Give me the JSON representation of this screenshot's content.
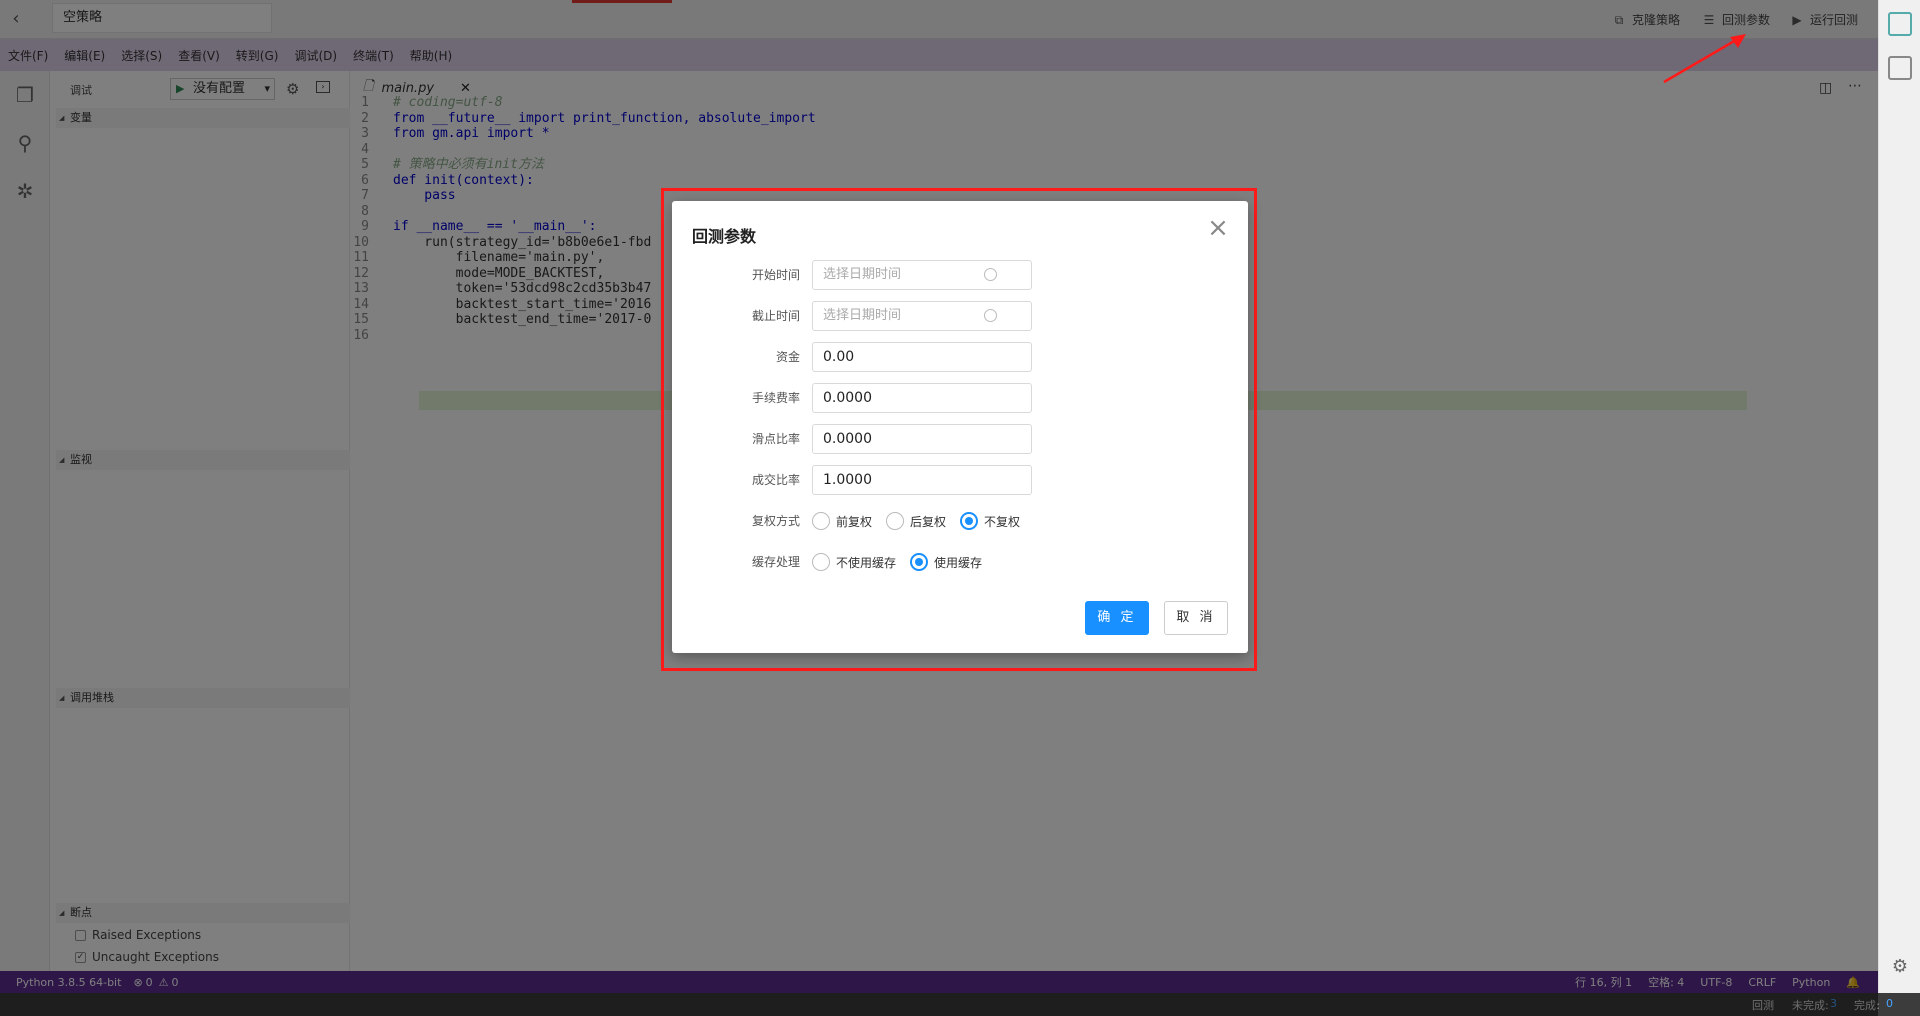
{
  "app": {
    "title": "空策略",
    "toolbar": {
      "clone_label": "克隆策略",
      "backtest_params_label": "回测参数",
      "run_backtest_label": "运行回测"
    }
  },
  "menu": [
    "文件(F)",
    "编辑(E)",
    "选择(S)",
    "查看(V)",
    "转到(G)",
    "调试(D)",
    "终端(T)",
    "帮助(H)"
  ],
  "sidebar": {
    "debug_label": "调试",
    "config_value": "没有配置",
    "sections": {
      "variables": "变量",
      "watch": "监视",
      "call_stack": "调用堆栈",
      "breakpoints": "断点"
    },
    "breakpoints": [
      {
        "label": "Raised Exceptions",
        "checked": false
      },
      {
        "label": "Uncaught Exceptions",
        "checked": true
      }
    ]
  },
  "editor": {
    "tab_name": "main.py",
    "lines": [
      {
        "n": "1",
        "t": "# coding=utf-8"
      },
      {
        "n": "2",
        "t": "from __future__ import print_function, absolute_import"
      },
      {
        "n": "3",
        "t": "from gm.api import *"
      },
      {
        "n": "4",
        "t": ""
      },
      {
        "n": "5",
        "t": "# 策略中必须有init方法"
      },
      {
        "n": "6",
        "t": "def init(context):"
      },
      {
        "n": "7",
        "t": "    pass"
      },
      {
        "n": "8",
        "t": ""
      },
      {
        "n": "9",
        "t": "if __name__ == '__main__':"
      },
      {
        "n": "10",
        "t": "    run(strategy_id='b8b0e6e1-fbd"
      },
      {
        "n": "11",
        "t": "        filename='main.py',"
      },
      {
        "n": "12",
        "t": "        mode=MODE_BACKTEST,"
      },
      {
        "n": "13",
        "t": "        token='53dcd98c2cd35b3b47"
      },
      {
        "n": "14",
        "t": "        backtest_start_time='2016"
      },
      {
        "n": "15",
        "t": "        backtest_end_time='2017-0"
      },
      {
        "n": "16",
        "t": ""
      }
    ]
  },
  "status": {
    "python": "Python 3.8.5 64-bit",
    "errors": "0",
    "warnings": "0",
    "position": "行 16, 列 1",
    "spaces": "空格: 4",
    "encoding": "UTF-8",
    "eol": "CRLF",
    "language": "Python"
  },
  "bottom": {
    "backtest": "回测",
    "incomplete_label": "未完成:",
    "incomplete_count": "3",
    "complete_label": "完成:",
    "complete_count": "0"
  },
  "modal": {
    "title": "回测参数",
    "fields": {
      "start_time": {
        "label": "开始时间",
        "placeholder": "选择日期时间"
      },
      "end_time": {
        "label": "截止时间",
        "placeholder": "选择日期时间"
      },
      "capital": {
        "label": "资金",
        "value": "0.00"
      },
      "commission": {
        "label": "手续费率",
        "value": "0.0000"
      },
      "slippage": {
        "label": "滑点比率",
        "value": "0.0000"
      },
      "fill_ratio": {
        "label": "成交比率",
        "value": "1.0000"
      }
    },
    "adjust": {
      "label": "复权方式",
      "options": [
        "前复权",
        "后复权",
        "不复权"
      ],
      "selected": "不复权"
    },
    "cache": {
      "label": "缓存处理",
      "options": [
        "不使用缓存",
        "使用缓存"
      ],
      "selected": "使用缓存"
    },
    "ok_label": "确 定",
    "cancel_label": "取 消"
  },
  "colors": {
    "menubar": "#ded3ec",
    "statusbar": "#5c2d91",
    "primary": "#1890ff",
    "highlight_frame": "#ff1a1a"
  }
}
